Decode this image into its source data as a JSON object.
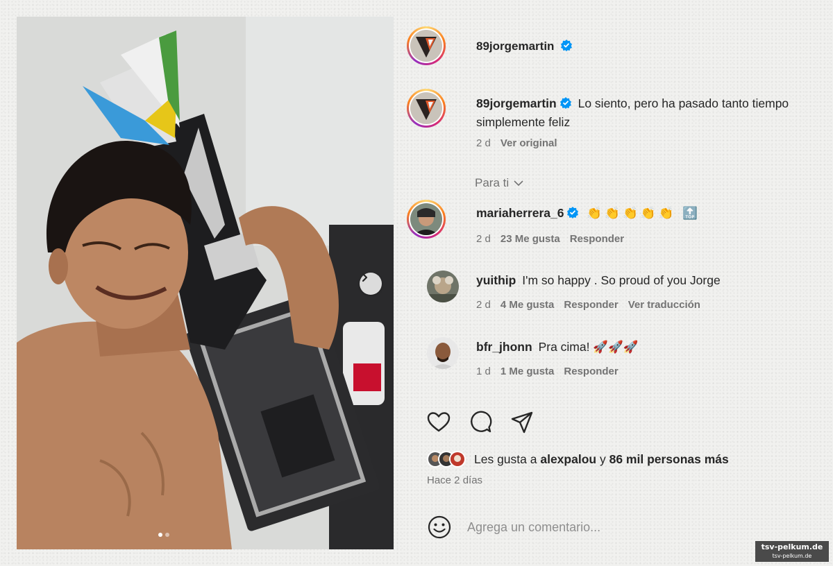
{
  "header": {
    "username": "89jorgemartin"
  },
  "caption": {
    "username": "89jorgemartin",
    "text": "Lo siento, pero ha pasado tanto tiempo simplemente feliz",
    "time": "2 d",
    "see_original": "Ver original"
  },
  "filter": {
    "label": "Para ti"
  },
  "comments": [
    {
      "username": "mariaherrera_6",
      "text": "👏👏👏👏👏 🔝",
      "time": "2 d",
      "likes": "23 Me gusta",
      "reply": "Responder",
      "translate": ""
    },
    {
      "username": "yuithip",
      "text": "I'm so happy . So proud of you Jorge",
      "time": "2 d",
      "likes": "4 Me gusta",
      "reply": "Responder",
      "translate": "Ver traducción"
    },
    {
      "username": "bfr_jhonn",
      "text": "Pra cima! 🚀🚀🚀",
      "time": "1 d",
      "likes": "1 Me gusta",
      "reply": "Responder",
      "translate": ""
    }
  ],
  "actions": {
    "like_icon": "heart-icon",
    "comment_icon": "comment-icon",
    "share_icon": "share-icon"
  },
  "likes": {
    "prefix": "Les gusta a",
    "user": "alexpalou",
    "connector": "y",
    "others": "86 mil personas más"
  },
  "posted": "Hace 2 días",
  "add_comment": {
    "placeholder": "Agrega un comentario..."
  },
  "carousel": {
    "current": 1,
    "total": 2
  },
  "watermark": {
    "line1": "tsv-pelkum.de",
    "line2": "tsv-pelkum.de"
  },
  "colors": {
    "verified": "#0095f6",
    "muted": "#737373",
    "text": "#262626"
  }
}
